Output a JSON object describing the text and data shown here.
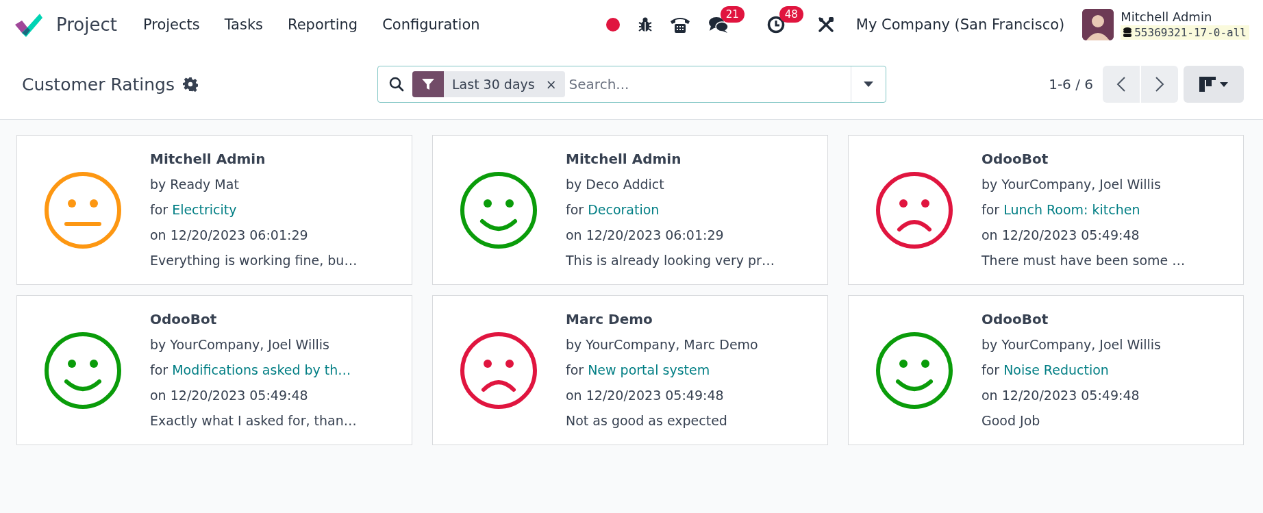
{
  "navbar": {
    "app_name": "Project",
    "menu": [
      "Projects",
      "Tasks",
      "Reporting",
      "Configuration"
    ],
    "messages_count": "21",
    "activities_count": "48",
    "company": "My Company (San Francisco)",
    "user": {
      "name": "Mitchell Admin",
      "database": "55369321-17-0-all"
    }
  },
  "control_panel": {
    "title": "Customer Ratings",
    "facet": {
      "label": "Last 30 days",
      "remove": "×"
    },
    "search": {
      "placeholder": "Search..."
    },
    "pager": "1-6 / 6"
  },
  "cards": [
    {
      "kind": "neutral",
      "name": "Mitchell Admin",
      "by": "by Ready Mat",
      "for_prefix": "for",
      "for_link": "Electricity",
      "date": "on 12/20/2023 06:01:29",
      "feedback": "Everything is working fine, bu…"
    },
    {
      "kind": "happy",
      "name": "Mitchell Admin",
      "by": "by Deco Addict",
      "for_prefix": "for",
      "for_link": "Decoration",
      "date": "on 12/20/2023 06:01:29",
      "feedback": "This is already looking very pr…"
    },
    {
      "kind": "sad",
      "name": "OdooBot",
      "by": "by YourCompany, Joel Willis",
      "for_prefix": "for",
      "for_link": "Lunch Room: kitchen",
      "date": "on 12/20/2023 05:49:48",
      "feedback": "There must have been some …"
    },
    {
      "kind": "happy",
      "name": "OdooBot",
      "by": "by YourCompany, Joel Willis",
      "for_prefix": "for",
      "for_link": "Modifications asked by th…",
      "date": "on 12/20/2023 05:49:48",
      "feedback": "Exactly what I asked for, than…"
    },
    {
      "kind": "sad",
      "name": "Marc Demo",
      "by": "by YourCompany, Marc Demo",
      "for_prefix": "for",
      "for_link": "New portal system",
      "date": "on 12/20/2023 05:49:48",
      "feedback": "Not as good as expected"
    },
    {
      "kind": "happy",
      "name": "OdooBot",
      "by": "by YourCompany, Joel Willis",
      "for_prefix": "for",
      "for_link": "Noise Reduction",
      "date": "on 12/20/2023 05:49:48",
      "feedback": "Good Job"
    }
  ]
}
